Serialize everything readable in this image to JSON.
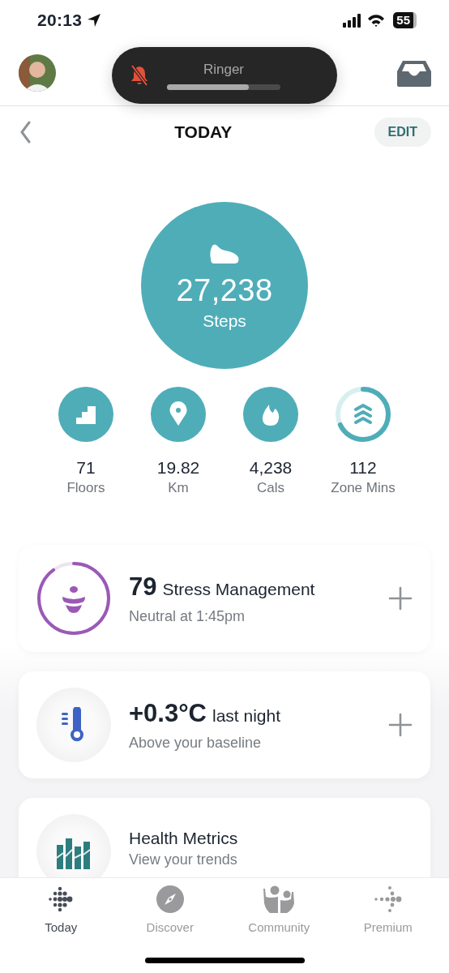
{
  "status_bar": {
    "time": "20:13",
    "battery_text": "55"
  },
  "ringer": {
    "title": "Ringer",
    "level": 0.72
  },
  "header": {
    "title": "TODAY",
    "edit_button": "EDIT"
  },
  "steps": {
    "value": "27,238",
    "label": "Steps"
  },
  "stats": [
    {
      "kind": "floors",
      "value": "71",
      "label": "Floors"
    },
    {
      "kind": "distance",
      "value": "19.82",
      "label": "Km"
    },
    {
      "kind": "calories",
      "value": "4,238",
      "label": "Cals"
    },
    {
      "kind": "zone",
      "value": "112",
      "label": "Zone Mins"
    }
  ],
  "cards": [
    {
      "kind": "stress",
      "value": "79",
      "title": "Stress Management",
      "subtitle": "Neutral at 1:45pm",
      "addable": true
    },
    {
      "kind": "temperature",
      "value": "+0.3°C",
      "title": "last night",
      "subtitle": "Above your baseline",
      "addable": true
    },
    {
      "kind": "metrics",
      "title": "Health Metrics",
      "subtitle": "View your trends",
      "addable": false
    }
  ],
  "tabs": [
    {
      "kind": "today",
      "label": "Today",
      "selected": true
    },
    {
      "kind": "discover",
      "label": "Discover",
      "selected": false
    },
    {
      "kind": "community",
      "label": "Community",
      "selected": false
    },
    {
      "kind": "premium",
      "label": "Premium",
      "selected": false
    }
  ]
}
